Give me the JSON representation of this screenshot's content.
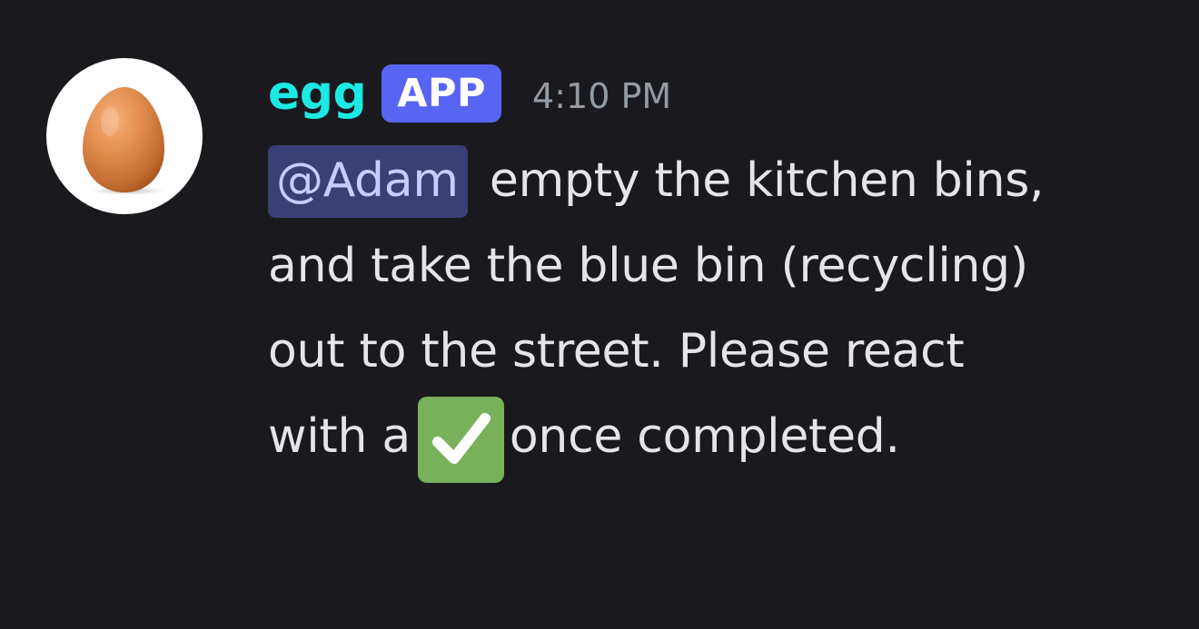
{
  "message": {
    "author": {
      "name": "egg",
      "avatar_icon": "egg-avatar-icon"
    },
    "badge": "APP",
    "timestamp": "4:10 PM",
    "mention": "@Adam",
    "text_line_1": "empty the kitchen bins,",
    "text_line_2": "and take the blue bin (recycling)",
    "text_line_3": "out to the street. Please react",
    "text_line_4_before": "with a",
    "emoji_icon": "white-check-mark-icon",
    "text_line_4_after": "once completed."
  },
  "colors": {
    "background": "#1a1a1e",
    "username": "#1de9e4",
    "badge": "#5865f2",
    "mention_bg": "#3b3f75",
    "mention_text": "#c9ccff",
    "timestamp": "#949ba4",
    "text": "#e3e5e8",
    "emoji_green": "#78b159"
  }
}
